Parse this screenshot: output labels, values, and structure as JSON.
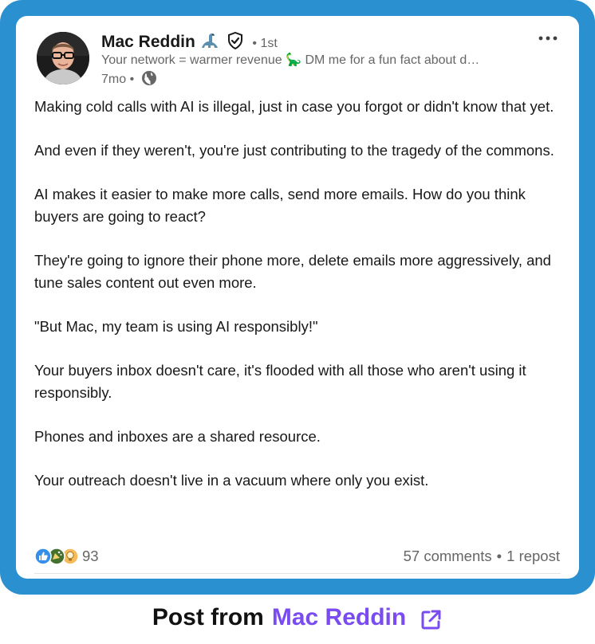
{
  "post": {
    "author_name": "Mac Reddin",
    "connection_degree": "• 1st",
    "headline": "Your network = warmer revenue 🦕 DM me for a fun fact about d…",
    "time_label": "7mo •",
    "paragraphs": [
      "Making cold calls with AI is illegal, just in case you forgot or didn't know that yet.",
      "And even if they weren't, you're just contributing to the tragedy of the commons.",
      "AI makes it easier to make more calls, send more emails. How do you think buyers are going to react?",
      "They're going to ignore their phone more, delete emails more aggressively, and tune sales content out even more.",
      "\"But Mac, my team is using AI responsibly!\"",
      "Your buyers inbox doesn't care, it's flooded with all those who aren't using it responsibly.",
      "Phones and inboxes are a shared resource.",
      "Your outreach doesn't live in a vacuum where only you exist."
    ],
    "reaction_count": "93",
    "reaction_icons": [
      "like-icon",
      "celebrate-icon",
      "insightful-icon"
    ],
    "comments_label": "57 comments",
    "stats_separator": "•",
    "reposts_label": "1 repost"
  },
  "footer": {
    "prefix": "Post from",
    "author_link": "Mac Reddin"
  },
  "colors": {
    "frame": "#2b90cf",
    "footer_link": "#7a4bf0",
    "secondary_text": "#666666"
  }
}
